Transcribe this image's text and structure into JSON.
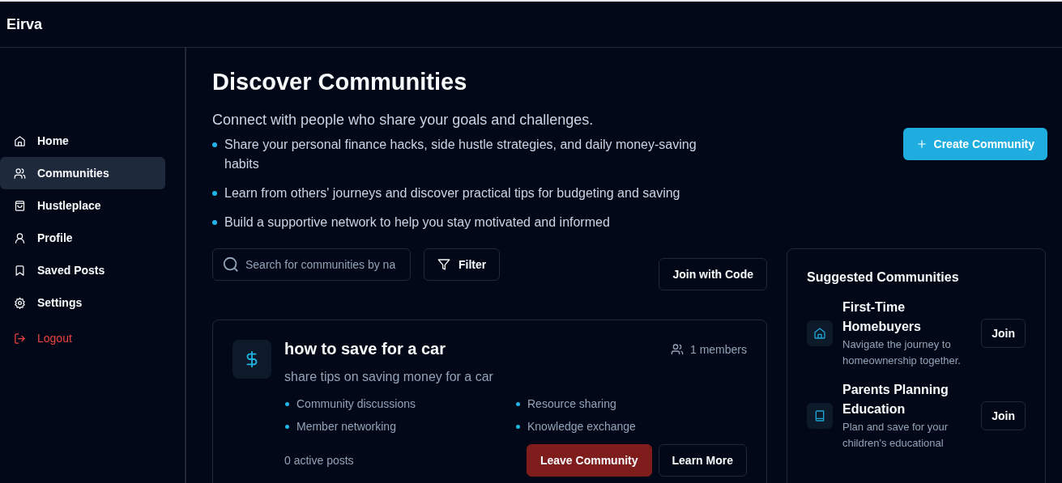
{
  "app": {
    "name": "Eirva"
  },
  "sidebar": {
    "items": [
      {
        "label": "Home",
        "kind": "home",
        "selected": false
      },
      {
        "label": "Communities",
        "kind": "users",
        "selected": true
      },
      {
        "label": "Hustleplace",
        "kind": "bag",
        "selected": false
      },
      {
        "label": "Profile",
        "kind": "user",
        "selected": false
      },
      {
        "label": "Saved Posts",
        "kind": "bookmark",
        "selected": false
      },
      {
        "label": "Settings",
        "kind": "gear",
        "selected": false
      },
      {
        "label": "Logout",
        "kind": "logout",
        "selected": false
      }
    ]
  },
  "header": {
    "title": "Discover Communities",
    "subtitle": "Connect with people who share your goals and challenges.",
    "bullets": [
      "Share your personal finance hacks, side hustle strategies, and daily money-saving habits",
      "Learn from others' journeys and discover practical tips for budgeting and saving",
      "Build a supportive network to help you stay motivated and informed"
    ],
    "create_button": "Create Community"
  },
  "search": {
    "placeholder": "Search for communities by na"
  },
  "filter_button": "Filter",
  "join_code_button": "Join with Code",
  "communities": [
    {
      "name": "how to save for a car",
      "members": "1 members",
      "description": "share tips on saving money for a car",
      "features": [
        "Community discussions",
        "Resource sharing",
        "Member networking",
        "Knowledge exchange"
      ],
      "posts": "0 active posts",
      "leave_button": "Leave Community",
      "learn_button": "Learn More"
    }
  ],
  "suggested": {
    "title": "Suggested Communities",
    "items": [
      {
        "name": "First-Time Homebuyers",
        "kind": "house",
        "description": "Navigate the journey to homeownership together.",
        "button": "Join"
      },
      {
        "name": "Parents Planning Education",
        "kind": "book",
        "description": "Plan and save for your children's educational",
        "button": "Join"
      }
    ]
  }
}
